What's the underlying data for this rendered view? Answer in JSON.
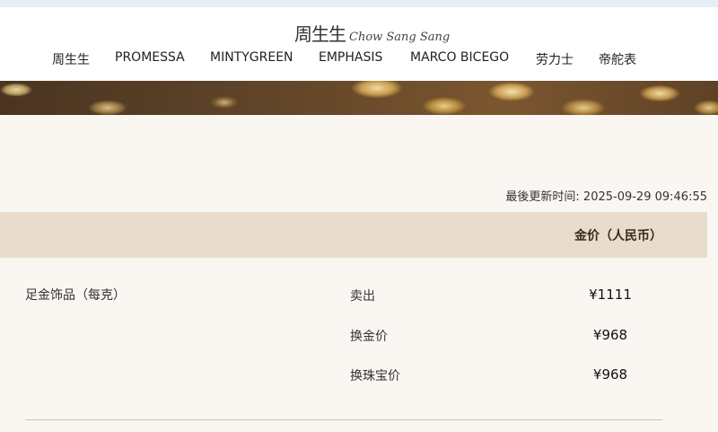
{
  "header": {
    "logo_cn": "周生生",
    "logo_en": "Chow Sang Sang",
    "nav": [
      {
        "label": "周生生"
      },
      {
        "label": "PROMESSA"
      },
      {
        "label": "MINTYGREEN"
      },
      {
        "label": "EMPHASIS"
      },
      {
        "label": "MARCO BICEGO"
      },
      {
        "label": "劳力士"
      },
      {
        "label": "帝舵表"
      }
    ]
  },
  "prices": {
    "last_updated": "最後更新时间: 2025-09-29 09:46:55",
    "column_header": "金价（人民币）",
    "product": "足金饰品（每克）",
    "rows": [
      {
        "label": "卖出",
        "value": "¥1111"
      },
      {
        "label": "换金价",
        "value": "¥968"
      },
      {
        "label": "换珠宝价",
        "value": "¥968"
      }
    ]
  },
  "colors": {
    "accent_header_bg": "#e9dccc",
    "content_bg": "#faf7f2"
  }
}
